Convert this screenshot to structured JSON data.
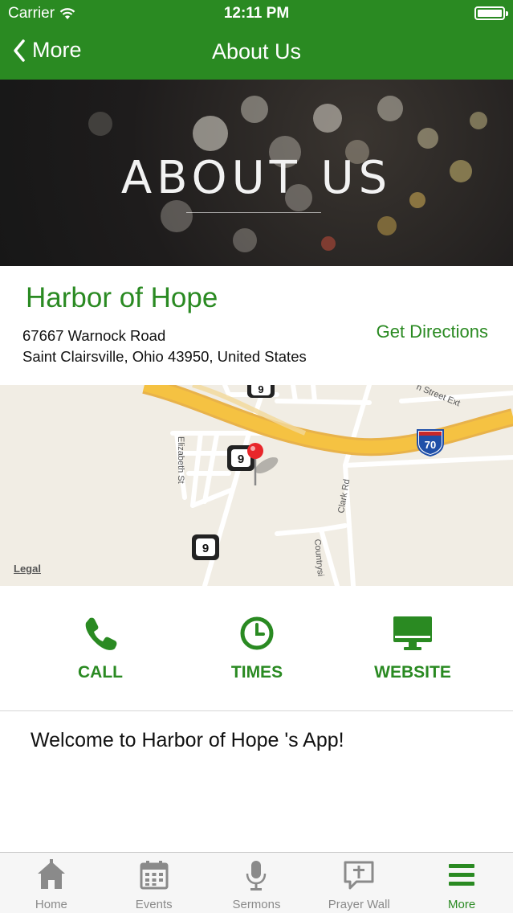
{
  "status_bar": {
    "carrier": "Carrier",
    "time": "12:11 PM"
  },
  "nav": {
    "back_label": "More",
    "title": "About Us"
  },
  "banner": {
    "heading": "ABOUT US"
  },
  "info": {
    "name": "Harbor of Hope",
    "address_line1": "67667 Warnock Road",
    "address_line2": "Saint Clairsville, Ohio 43950, United States",
    "directions_label": "Get Directions"
  },
  "map": {
    "legal_label": "Legal",
    "road_labels": {
      "elizabeth": "Elizabeth St",
      "clark": "Clark Rd",
      "countryside": "Countrysi",
      "street_ext": "n Street Ext"
    },
    "route_shield_9": "9",
    "interstate_shield": "70"
  },
  "actions": [
    {
      "label": "CALL",
      "icon": "phone-icon"
    },
    {
      "label": "TIMES",
      "icon": "clock-icon"
    },
    {
      "label": "WEBSITE",
      "icon": "monitor-icon"
    }
  ],
  "welcome_text": "Welcome to Harbor of Hope 's App!",
  "tabs": [
    {
      "label": "Home",
      "icon": "home-icon",
      "active": false
    },
    {
      "label": "Events",
      "icon": "calendar-icon",
      "active": false
    },
    {
      "label": "Sermons",
      "icon": "microphone-icon",
      "active": false
    },
    {
      "label": "Prayer Wall",
      "icon": "prayer-wall-icon",
      "active": false
    },
    {
      "label": "More",
      "icon": "menu-icon",
      "active": true
    }
  ],
  "colors": {
    "brand_green": "#2a8a22",
    "tab_inactive": "#8a8a8a",
    "highway": "#f5c242",
    "map_bg": "#f1ede4"
  }
}
